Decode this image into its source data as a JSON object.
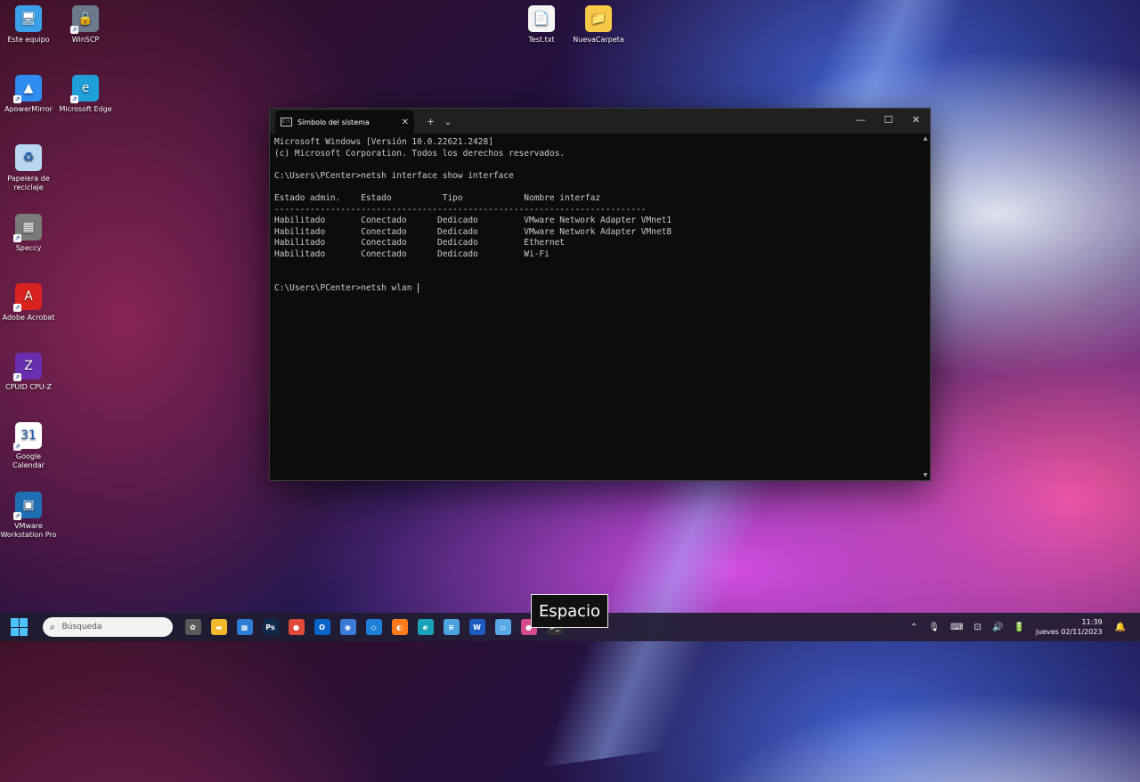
{
  "desktop": {
    "icons": [
      {
        "label": "Este equipo",
        "glyph": "🖥",
        "color": "#3aa0e8"
      },
      {
        "label": "WinSCP",
        "glyph": "🔒",
        "color": "#6b7b8c"
      },
      {
        "label": "ApowerMirror",
        "glyph": "▲",
        "color": "#2f8cf0"
      },
      {
        "label": "Microsoft Edge",
        "glyph": "e",
        "color": "#1f9fd8"
      },
      {
        "label": "Papelera de reciclaje",
        "glyph": "♻",
        "color": "#b8d7f0"
      },
      {
        "label": "Speccy",
        "glyph": "▦",
        "color": "#7a7a7a"
      },
      {
        "label": "Adobe Acrobat",
        "glyph": "A",
        "color": "#d9231f"
      },
      {
        "label": "CPUID CPU-Z",
        "glyph": "Z",
        "color": "#6a2fb0"
      },
      {
        "label": "Google Calendar",
        "glyph": "31",
        "color": "#ffffff"
      },
      {
        "label": "VMware Workstation Pro",
        "glyph": "▣",
        "color": "#1f6fb5"
      },
      {
        "label": "Test.txt",
        "glyph": "📄",
        "color": "#f4f4f4"
      },
      {
        "label": "NuevaCarpeta",
        "glyph": "📁",
        "color": "#f7c948"
      }
    ]
  },
  "terminal": {
    "tab_title": "Símbolo del sistema",
    "tab_icon": "C:\\",
    "new_tab": "+",
    "dropdown": "⌄",
    "close_tab": "✕",
    "controls": {
      "minimize": "—",
      "maximize": "☐",
      "close": "✕"
    },
    "lines": [
      "Microsoft Windows [Versión 10.0.22621.2428]",
      "(c) Microsoft Corporation. Todos los derechos reservados.",
      "",
      "C:\\Users\\PCenter>netsh interface show interface",
      "",
      "Estado admin.    Estado          Tipo            Nombre interfaz",
      "-------------------------------------------------------------------------",
      "Habilitado       Conectado      Dedicado         VMware Network Adapter VMnet1",
      "Habilitado       Conectado      Dedicado         VMware Network Adapter VMnet8",
      "Habilitado       Conectado      Dedicado         Ethernet",
      "Habilitado       Conectado      Dedicado         Wi-Fi",
      "",
      ""
    ],
    "prompt_line": "C:\\Users\\PCenter>netsh wlan "
  },
  "key_overlay": "Espacio",
  "taskbar": {
    "search_placeholder": "Búsqueda",
    "apps": [
      {
        "name": "chatgpt-app",
        "glyph": "✿",
        "color": "#5a5a5a"
      },
      {
        "name": "file-explorer",
        "glyph": "▬",
        "color": "#f2b82c"
      },
      {
        "name": "microsoft-store",
        "glyph": "▦",
        "color": "#2d7dd2"
      },
      {
        "name": "photoshop",
        "glyph": "Ps",
        "color": "#0f2a4a"
      },
      {
        "name": "chrome",
        "glyph": "●",
        "color": "#e04a3a"
      },
      {
        "name": "outlook",
        "glyph": "O",
        "color": "#0a64c8"
      },
      {
        "name": "copilot",
        "glyph": "◉",
        "color": "#3b7bd8"
      },
      {
        "name": "vscode",
        "glyph": "◇",
        "color": "#1e7fd8"
      },
      {
        "name": "firefox",
        "glyph": "◐",
        "color": "#ff7a1a"
      },
      {
        "name": "edge",
        "glyph": "e",
        "color": "#19a3b8"
      },
      {
        "name": "notepad",
        "glyph": "≡",
        "color": "#4aa3e0"
      },
      {
        "name": "word",
        "glyph": "W",
        "color": "#1d5bbf"
      },
      {
        "name": "remote-desktop",
        "glyph": "▱",
        "color": "#5aa9e6"
      },
      {
        "name": "chrome-dev",
        "glyph": "●",
        "color": "#d64a8a"
      },
      {
        "name": "terminal",
        "glyph": ">_",
        "color": "#333333"
      }
    ],
    "tray": {
      "chevron": "⌃",
      "mic": "🎙",
      "keyboard": "⌨",
      "network": "⊡",
      "volume": "🔊",
      "battery": "🔋",
      "notification": "🔔"
    },
    "time": "11:39",
    "date": "jueves 02/11/2023"
  }
}
